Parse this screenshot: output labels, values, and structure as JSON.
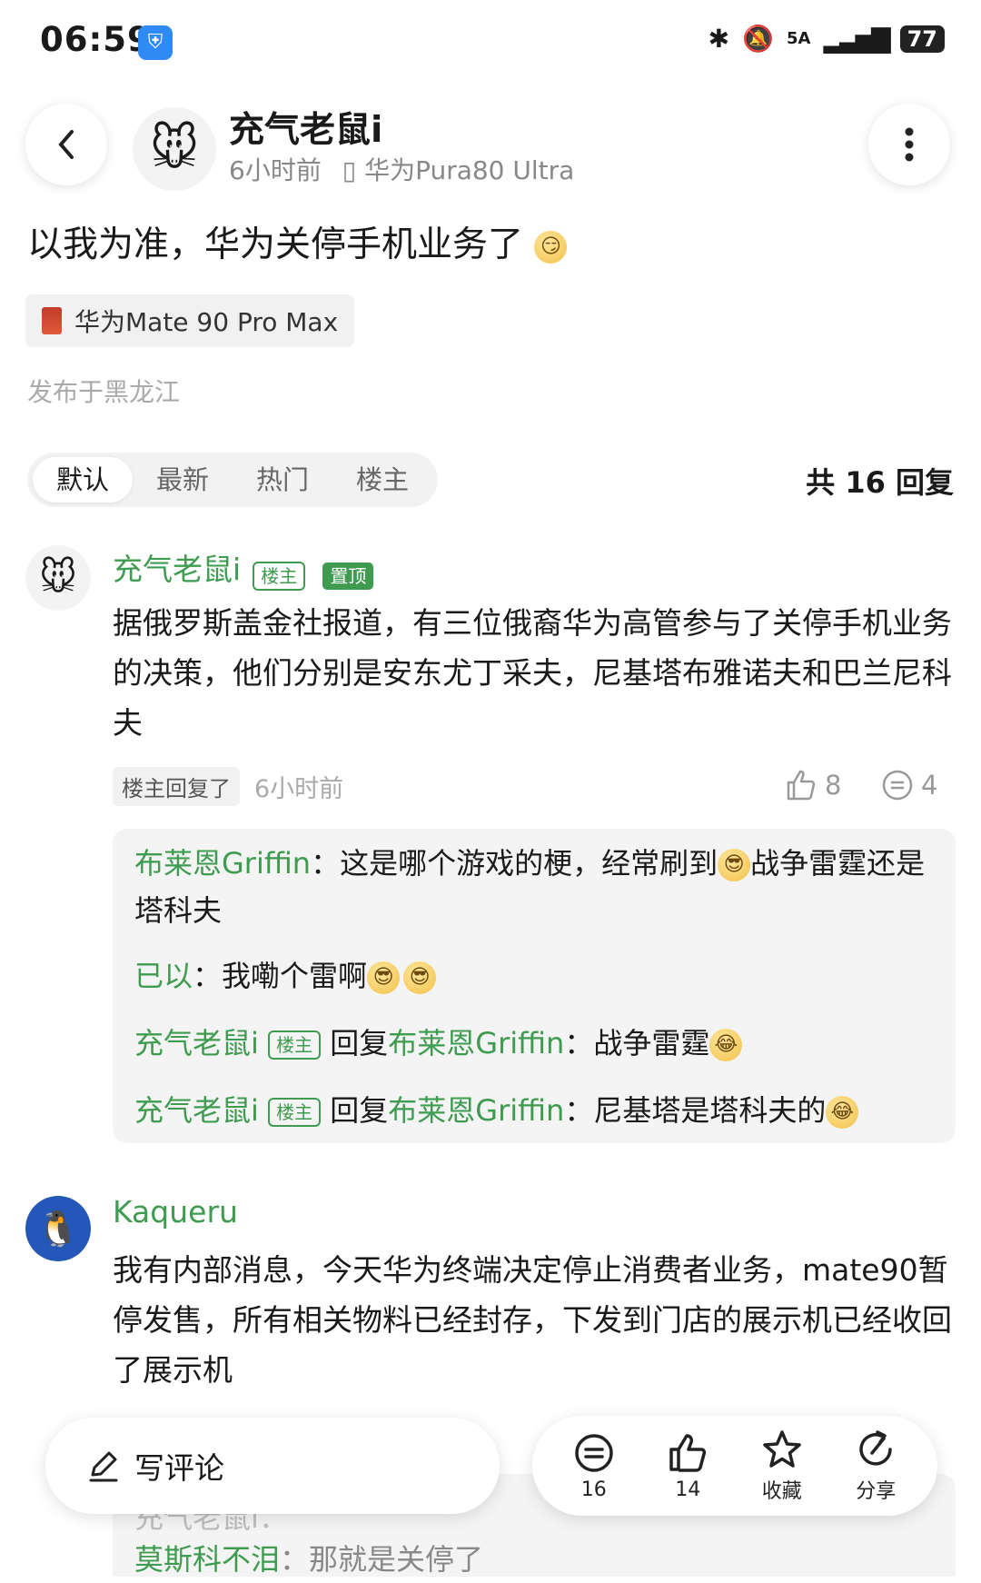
{
  "status_bar": {
    "time": "06:59",
    "battery": "77",
    "network": "5A"
  },
  "header": {
    "author": "充气老鼠i",
    "time_ago": "6小时前",
    "device": "华为Pura80 Ultra"
  },
  "post": {
    "text": "以我为准，华为关停手机业务了",
    "device_tag": "华为Mate 90 Pro Max",
    "location": "发布于黑龙江"
  },
  "tabs": [
    "默认",
    "最新",
    "热门",
    "楼主"
  ],
  "reply_count": "共 16 回复",
  "comments": [
    {
      "author": "充气老鼠i",
      "badge_owner": "楼主",
      "badge_pinned": "置顶",
      "text": "据俄罗斯盖金社报道，有三位俄裔华为高管参与了关停手机业务的决策，他们分别是安东尤丁采夫，尼基塔布雅诺夫和巴兰尼科夫",
      "reply_tag": "楼主回复了",
      "time": "6小时前",
      "likes": "8",
      "comments": "4",
      "replies": [
        {
          "user": "布莱恩Griffin",
          "text": "：这是哪个游戏的梗，经常刷到",
          "text2": "战争雷霆还是塔科夫"
        },
        {
          "user": "已以",
          "text": "：我嘞个雷啊"
        },
        {
          "user": "充气老鼠i",
          "badge": "楼主",
          "reply_word": "回复",
          "target": "布莱恩Griffin",
          "text": "：战争雷霆"
        },
        {
          "user": "充气老鼠i",
          "badge": "楼主",
          "reply_word": "回复",
          "target": "布莱恩Griffin",
          "text": "：尼基塔是塔科夫的"
        }
      ]
    },
    {
      "author": "Kaqueru",
      "text": "我有内部消息，今天华为终端决定停止消费者业务，mate90暂停发售，所有相关物料已经封存，下发到门店的展示机已经收回了展示机"
    }
  ],
  "hidden_replies": [
    {
      "user": "充气老鼠i",
      "text": "："
    },
    {
      "user": "莫斯科不泪",
      "text": "：那就是关停了"
    }
  ],
  "bottom_bar": {
    "write_comment": "写评论",
    "comment_count": "16",
    "like_count": "14",
    "favorite": "收藏",
    "share": "分享"
  },
  "colors": {
    "accent_green": "#3e9b4f",
    "shield_blue": "#2f8af5"
  }
}
